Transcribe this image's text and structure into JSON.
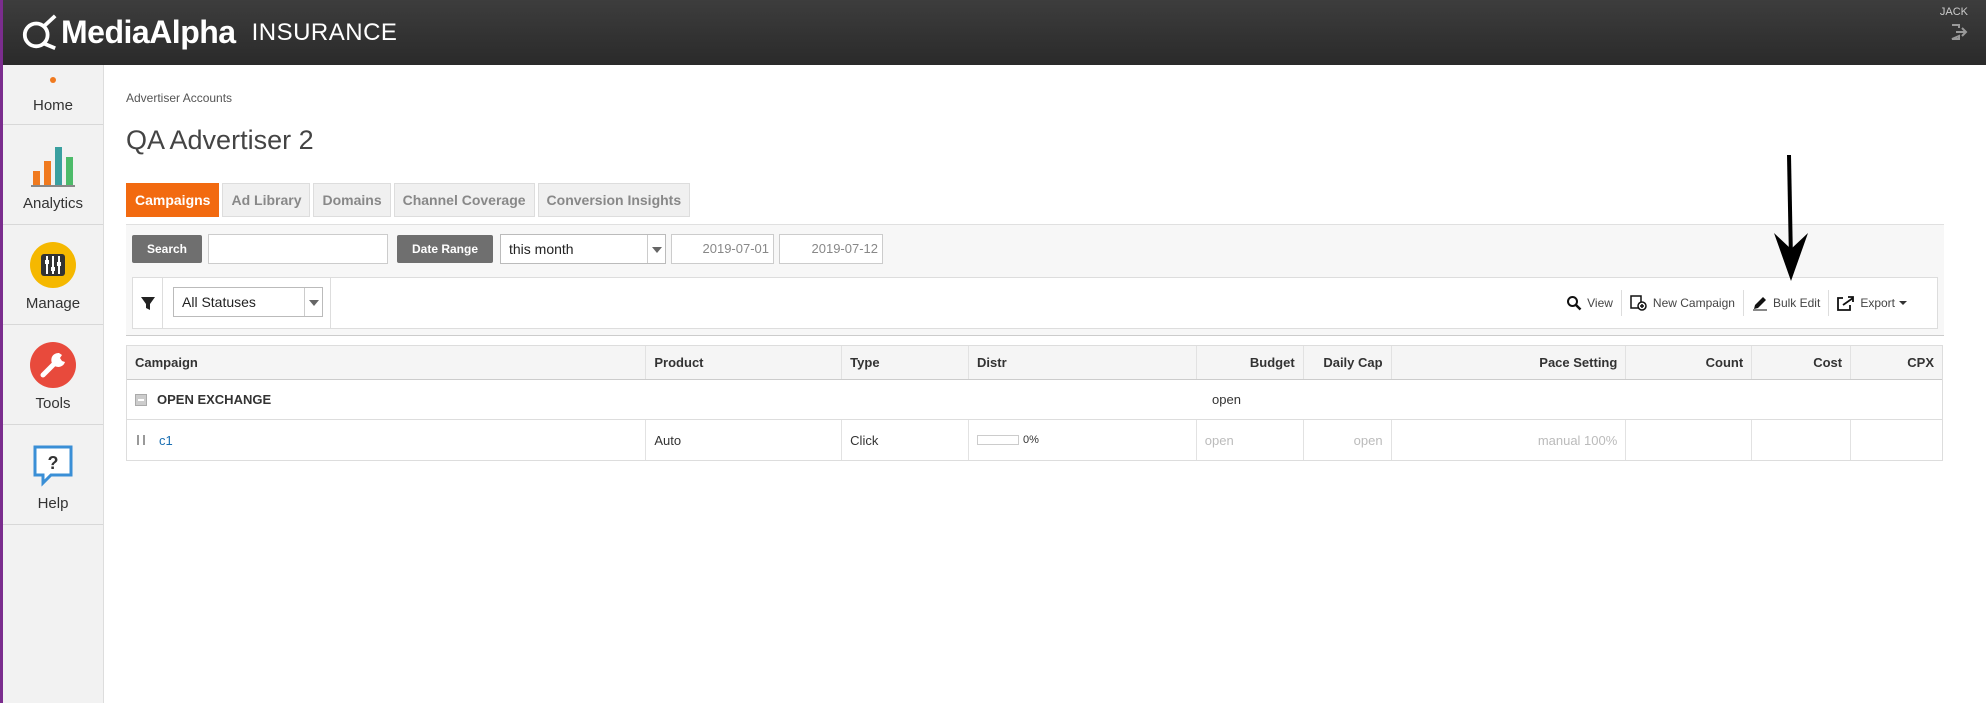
{
  "header": {
    "brand": "MediaAlpha",
    "product": "INSURANCE",
    "user": "JACK"
  },
  "sidebar": {
    "items": [
      {
        "label": "Home",
        "icon": "home-dot-icon"
      },
      {
        "label": "Analytics",
        "icon": "bar-chart-icon"
      },
      {
        "label": "Manage",
        "icon": "sliders-icon"
      },
      {
        "label": "Tools",
        "icon": "wrench-icon"
      },
      {
        "label": "Help",
        "icon": "help-bubble-icon"
      }
    ]
  },
  "breadcrumb": "Advertiser Accounts",
  "page_title": "QA Advertiser 2",
  "tabs": [
    {
      "label": "Campaigns",
      "active": true
    },
    {
      "label": "Ad Library",
      "active": false
    },
    {
      "label": "Domains",
      "active": false
    },
    {
      "label": "Channel Coverage",
      "active": false
    },
    {
      "label": "Conversion Insights",
      "active": false
    }
  ],
  "filters": {
    "search_label": "Search",
    "search_value": "",
    "date_range_label": "Date Range",
    "date_range_value": "this month",
    "start_date": "2019-07-01",
    "end_date": "2019-07-12",
    "status_value": "All Statuses"
  },
  "toolbar": {
    "view": "View",
    "new_campaign": "New Campaign",
    "bulk_edit": "Bulk Edit",
    "export": "Export"
  },
  "table": {
    "columns": [
      "Campaign",
      "Product",
      "Type",
      "Distr",
      "Budget",
      "Daily Cap",
      "Pace Setting",
      "Count",
      "Cost",
      "CPX"
    ],
    "group": {
      "name": "OPEN EXCHANGE",
      "budget": "open"
    },
    "rows": [
      {
        "campaign": "c1",
        "product": "Auto",
        "type": "Click",
        "distr": "0%",
        "distr_fraction": 0,
        "budget": "open",
        "daily_cap": "open",
        "pace": "manual 100%",
        "count": "",
        "cost": "",
        "cpx": ""
      }
    ]
  },
  "colors": {
    "accent": "#f26a10",
    "header_bg": "#2f2f2f",
    "link": "#1a6fb3",
    "sidebar_border": "#7b2d8e"
  }
}
